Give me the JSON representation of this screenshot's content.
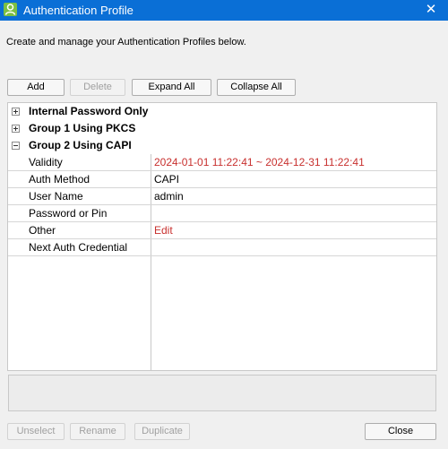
{
  "window": {
    "title": "Authentication Profile",
    "close_glyph": "✕"
  },
  "description": "Create and manage your Authentication Profiles below.",
  "toolbar": {
    "add": "Add",
    "delete": "Delete",
    "expand_all": "Expand All",
    "collapse_all": "Collapse All"
  },
  "tree": {
    "groups": [
      {
        "label": "Internal Password Only",
        "state": "collapsed"
      },
      {
        "label": "Group 1 Using PKCS",
        "state": "collapsed"
      },
      {
        "label": "Group 2 Using CAPI",
        "state": "expanded"
      }
    ],
    "properties": [
      {
        "name": "Validity",
        "value": "2024-01-01 11:22:41 ~ 2024-12-31 11:22:41",
        "color": "#c8302e"
      },
      {
        "name": "Auth Method",
        "value": "CAPI"
      },
      {
        "name": "User Name",
        "value": "admin"
      },
      {
        "name": "Password or Pin",
        "value": ""
      },
      {
        "name": "Other",
        "value": "Edit",
        "color": "#c8302e"
      },
      {
        "name": "Next Auth Credential",
        "value": ""
      }
    ]
  },
  "footer": {
    "unselect": "Unselect",
    "rename": "Rename",
    "duplicate": "Duplicate",
    "close": "Close"
  },
  "colors": {
    "titlebar": "#0a6fd6",
    "accent_red": "#c8302e",
    "app_icon": "#7cc043"
  },
  "icons": {
    "app": "user-profile-icon",
    "expand": "plus-box-icon",
    "collapse": "minus-box-icon"
  }
}
